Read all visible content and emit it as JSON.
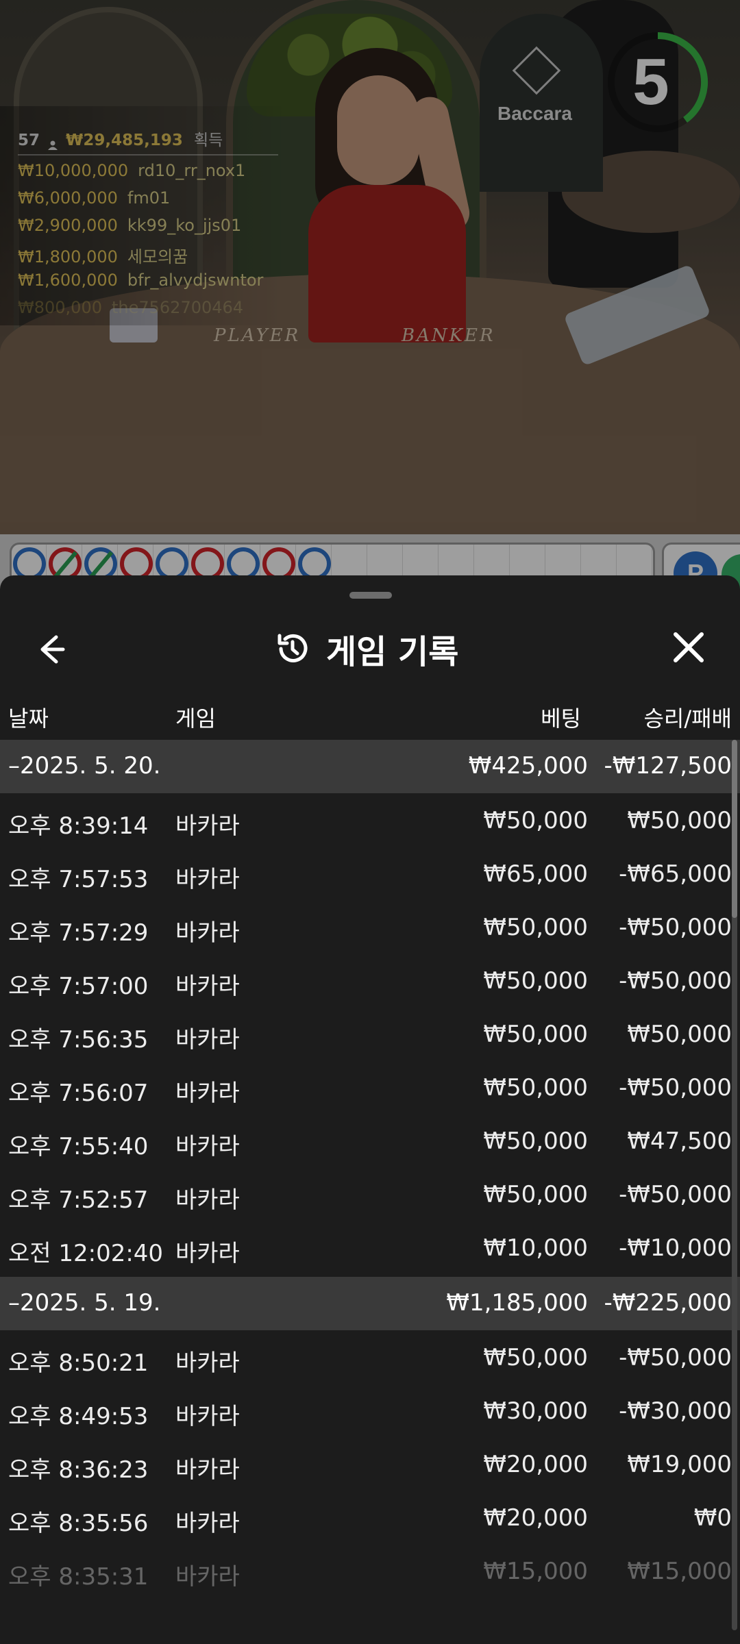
{
  "video": {
    "timer": "5",
    "table_sign": "Baccara",
    "table_labels": {
      "player": "PLAYER",
      "banker": "BANKER"
    },
    "winners_summary": {
      "count": "57",
      "total": "₩29,485,193",
      "label": "획득"
    },
    "winners": [
      {
        "amount": "₩10,000,000",
        "name": "rd10_rr_nox1"
      },
      {
        "amount": "₩6,000,000",
        "name": "fm01"
      },
      {
        "amount": "₩2,900,000",
        "name": "kk99_ko_jjs01"
      },
      {
        "amount": "₩1,800,000",
        "name": "세모의꿈"
      },
      {
        "amount": "₩1,600,000",
        "name": "bfr_alvydjswntor"
      },
      {
        "amount": "₩800,000",
        "name": "the7562700464"
      }
    ]
  },
  "roadmap": {
    "bead_label": "P",
    "cells": [
      {
        "side": "p",
        "tie": false
      },
      {
        "side": "b",
        "tie": true
      },
      {
        "side": "p",
        "tie": true
      },
      {
        "side": "b",
        "tie": false
      },
      {
        "side": "p",
        "tie": false
      },
      {
        "side": "b",
        "tie": false
      },
      {
        "side": "p",
        "tie": false
      },
      {
        "side": "b",
        "tie": false
      },
      {
        "side": "p",
        "tie": false
      }
    ],
    "colors": {
      "player": "#2f72c8",
      "banker": "#d3252a",
      "tie": "#2aa155"
    }
  },
  "sheet": {
    "title": "게임 기록",
    "icons": {
      "back": "arrow-left-icon",
      "history": "history-icon",
      "close": "close-icon"
    },
    "columns": {
      "date": "날짜",
      "game": "게임",
      "bet": "베팅",
      "result": "승리/패배"
    },
    "groups": [
      {
        "date": "–2025. 5. 20.",
        "bet_total": "₩425,000",
        "result_total": "-₩127,500",
        "rows": [
          {
            "time": "오후 8:39:14",
            "game": "바카라",
            "bet": "₩50,000",
            "result": "₩50,000"
          },
          {
            "time": "오후 7:57:53",
            "game": "바카라",
            "bet": "₩65,000",
            "result": "-₩65,000"
          },
          {
            "time": "오후 7:57:29",
            "game": "바카라",
            "bet": "₩50,000",
            "result": "-₩50,000"
          },
          {
            "time": "오후 7:57:00",
            "game": "바카라",
            "bet": "₩50,000",
            "result": "-₩50,000"
          },
          {
            "time": "오후 7:56:35",
            "game": "바카라",
            "bet": "₩50,000",
            "result": "₩50,000"
          },
          {
            "time": "오후 7:56:07",
            "game": "바카라",
            "bet": "₩50,000",
            "result": "-₩50,000"
          },
          {
            "time": "오후 7:55:40",
            "game": "바카라",
            "bet": "₩50,000",
            "result": "₩47,500"
          },
          {
            "time": "오후 7:52:57",
            "game": "바카라",
            "bet": "₩50,000",
            "result": "-₩50,000"
          },
          {
            "time": "오전 12:02:40",
            "game": "바카라",
            "bet": "₩10,000",
            "result": "-₩10,000"
          }
        ]
      },
      {
        "date": "–2025. 5. 19.",
        "bet_total": "₩1,185,000",
        "result_total": "-₩225,000",
        "rows": [
          {
            "time": "오후 8:50:21",
            "game": "바카라",
            "bet": "₩50,000",
            "result": "-₩50,000"
          },
          {
            "time": "오후 8:49:53",
            "game": "바카라",
            "bet": "₩30,000",
            "result": "-₩30,000"
          },
          {
            "time": "오후 8:36:23",
            "game": "바카라",
            "bet": "₩20,000",
            "result": "₩19,000"
          },
          {
            "time": "오후 8:35:56",
            "game": "바카라",
            "bet": "₩20,000",
            "result": "₩0"
          },
          {
            "time": "오후 8:35:31",
            "game": "바카라",
            "bet": "₩15,000",
            "result": "₩15,000"
          }
        ]
      }
    ]
  }
}
